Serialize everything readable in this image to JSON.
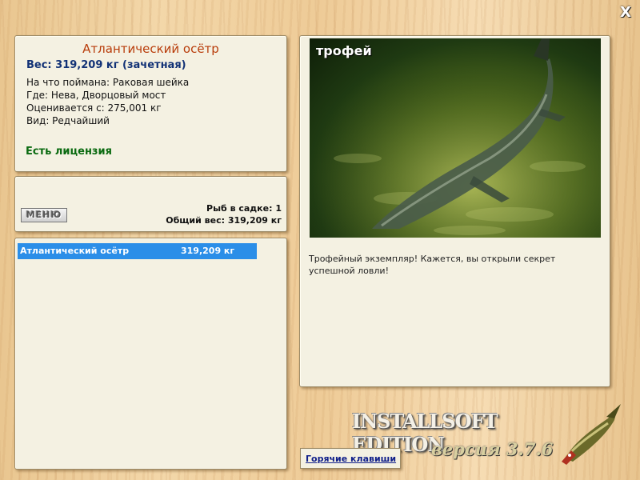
{
  "window": {
    "close_label": "X"
  },
  "catch_info": {
    "fish_name": "Атлантический осётр",
    "weight_line": "Вес: 319,209 кг (зачетная)",
    "bait": "На что поймана: Раковая шейка",
    "location": "Где: Нева, Дворцовый мост",
    "valued_from": "Оценивается с: 275,001 кг",
    "kind": "Вид: Редчайший",
    "license": "Есть лицензия"
  },
  "summary": {
    "menu_label": "МЕНЮ",
    "fish_count": "Рыб в садке: 1",
    "total_weight": "Общий вес: 319,209 кг"
  },
  "keepnet": {
    "items": [
      {
        "name": "Атлантический осётр",
        "weight": "319,209 кг"
      }
    ]
  },
  "trophy": {
    "photo_label": "трофей",
    "photo_subject": "sturgeon-photo",
    "message": "Трофейный экземпляр! Кажется, вы открыли секрет успешной ловли!"
  },
  "footer": {
    "brand": "INSTALLSOFT EDITION",
    "version": "версия 3.7.6",
    "hotkeys_link": "Горячие клавиши",
    "logo_icon": "pike-fish-icon"
  },
  "colors": {
    "title": "#b83c0a",
    "weight": "#123276",
    "license": "#0a6a10",
    "selection": "#2b8ee8"
  }
}
